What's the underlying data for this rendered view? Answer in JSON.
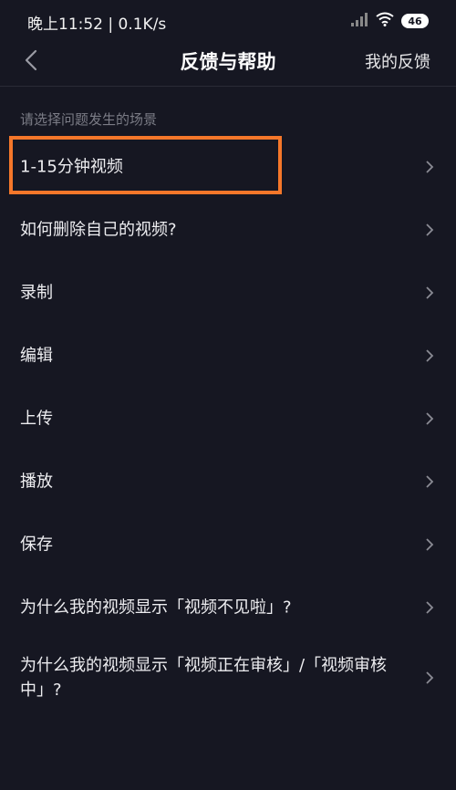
{
  "status_bar": {
    "time_speed": "晚上11:52 | 0.1K/s",
    "battery": "46"
  },
  "header": {
    "title": "反馈与帮助",
    "my_feedback": "我的反馈"
  },
  "section_label": "请选择问题发生的场景",
  "items": [
    {
      "label": "1-15分钟视频"
    },
    {
      "label": "如何删除自己的视频?"
    },
    {
      "label": "录制"
    },
    {
      "label": "编辑"
    },
    {
      "label": "上传"
    },
    {
      "label": "播放"
    },
    {
      "label": "保存"
    },
    {
      "label": "为什么我的视频显示「视频不见啦」?"
    },
    {
      "label": "为什么我的视频显示「视频正在审核」/「视频审核中」?"
    }
  ],
  "colors": {
    "background": "#161722",
    "highlight": "#f5772a",
    "secondary_text": "#7b7c86"
  },
  "icons": [
    "back-arrow-icon",
    "signal-icon",
    "wifi-icon",
    "battery-icon",
    "chevron-right-icon"
  ]
}
